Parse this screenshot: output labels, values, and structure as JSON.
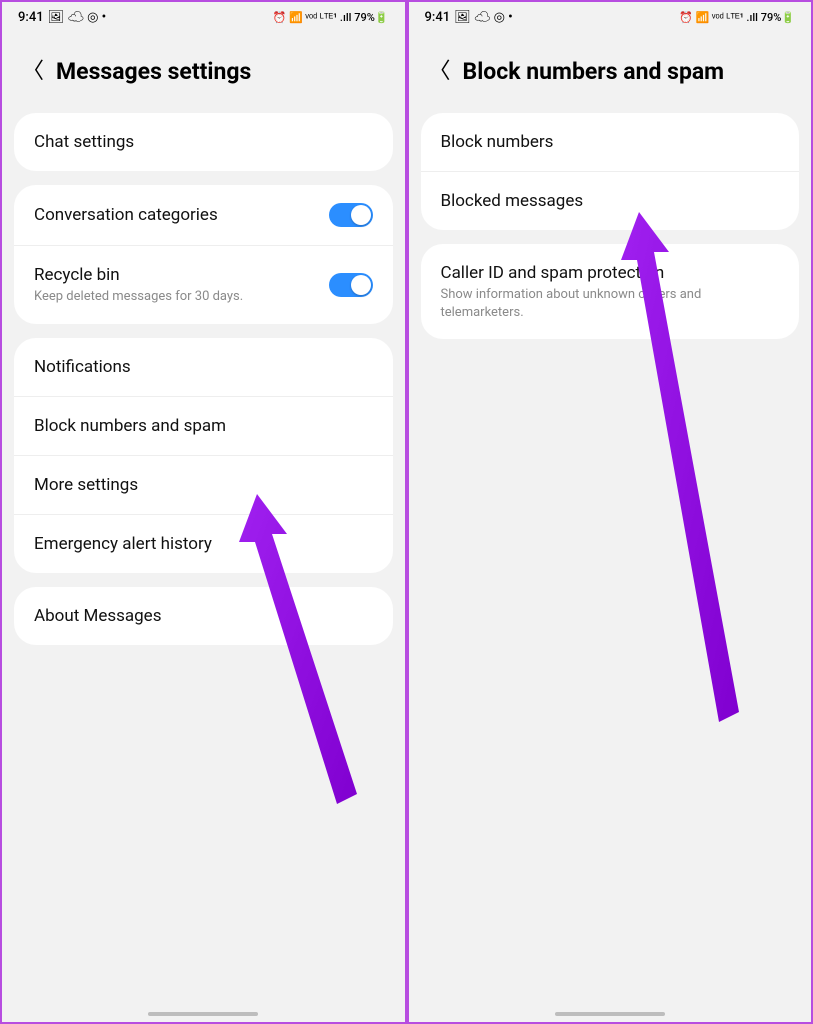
{
  "status": {
    "time": "9:41",
    "icons_left": "🖼 ☁ ◎ •",
    "icons_right": "⏰ 📶 ᵛᵒᵈ ᴸᵀᴱ¹ .ıll 79%🔋"
  },
  "left": {
    "title": "Messages settings",
    "card1": {
      "row1": "Chat settings"
    },
    "card2": {
      "row1": "Conversation categories",
      "row2": "Recycle bin",
      "row2_sub": "Keep deleted messages for 30 days."
    },
    "card3": {
      "row1": "Notifications",
      "row2": "Block numbers and spam",
      "row3": "More settings",
      "row4": "Emergency alert history"
    },
    "card4": {
      "row1": "About Messages"
    }
  },
  "right": {
    "title": "Block numbers and spam",
    "card1": {
      "row1": "Block numbers",
      "row2": "Blocked messages"
    },
    "card2": {
      "row1": "Caller ID and spam protection",
      "row1_sub": "Show information about unknown callers and telemarketers."
    }
  }
}
